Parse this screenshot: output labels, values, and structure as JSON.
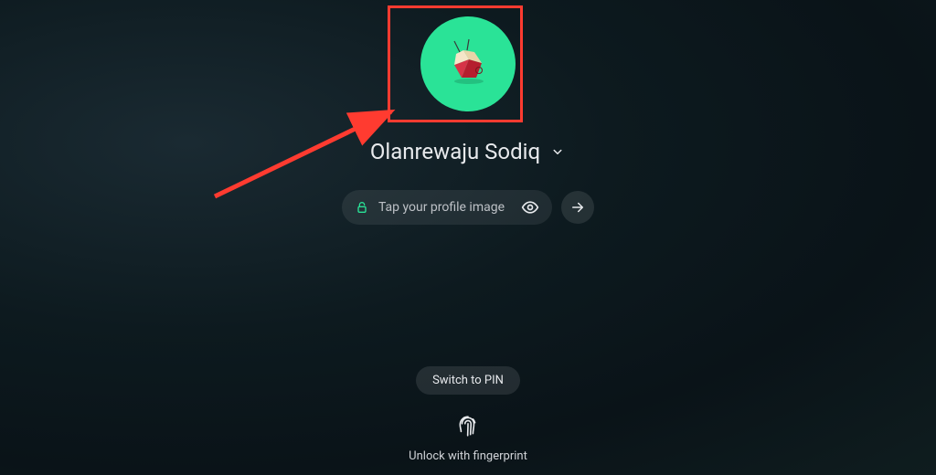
{
  "user": {
    "name": "Olanrewaju Sodiq",
    "avatar_bg": "#2ae397"
  },
  "input": {
    "placeholder": "Tap your profile image"
  },
  "switch_button": {
    "label": "Switch to PIN"
  },
  "fingerprint": {
    "label": "Unlock with fingerprint"
  },
  "annotation": {
    "color": "#ff3b30"
  }
}
